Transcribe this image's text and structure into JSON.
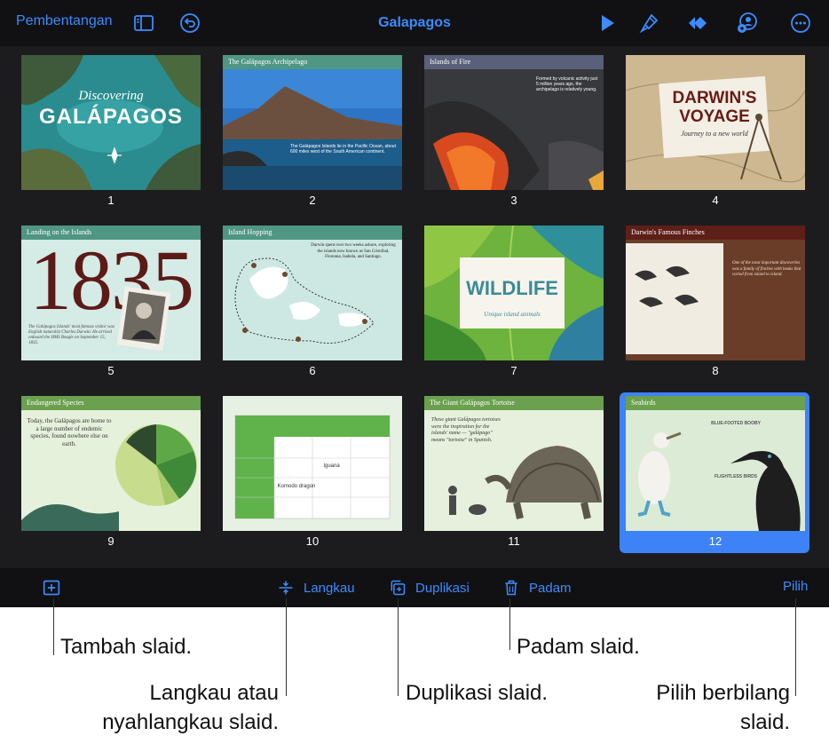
{
  "topbar": {
    "present_label": "Pembentangan",
    "title": "Galapagos",
    "icons": [
      "sidebar-icon",
      "undo-icon",
      "play-icon",
      "format-brush-icon",
      "animate-icon",
      "collaborate-icon",
      "more-icon"
    ]
  },
  "slides": [
    {
      "number": "1",
      "title": "Discovering",
      "big": "GALÁPAGOS"
    },
    {
      "number": "2",
      "title": "The Galápagos Archipelago",
      "bullet": "The Galápagos Islands lie in the Pacific Ocean, about 600 miles west of the South American continent."
    },
    {
      "number": "3",
      "title": "Islands of Fire",
      "text": "Formed by volcanic activity just 5 million years ago, the archipelago is relatively young."
    },
    {
      "number": "4",
      "title": "DARWIN'S VOYAGE",
      "subtitle": "Journey to a new world"
    },
    {
      "number": "5",
      "title": "Landing on the Islands",
      "big": "1835",
      "caption": "The Galápagos Islands' most famous visitor was English naturalist Charles Darwin. He arrived onboard the HMS Beagle on September 15, 1835."
    },
    {
      "number": "6",
      "title": "Island Hopping",
      "text": "Darwin spent over two weeks ashore, exploring the islands now known as San Cristóbal, Floreana, Isabela, and Santiago."
    },
    {
      "number": "7",
      "title": "WILDLIFE",
      "subtitle": "Unique island animals"
    },
    {
      "number": "8",
      "title": "Darwin's Famous Finches",
      "text": "One of the most important discoveries was a family of finches with beaks that varied from island to island."
    },
    {
      "number": "9",
      "title": "Endangered Species",
      "text": "Today, the Galápagos are home to a large number of endemic species, found nowhere else on earth."
    },
    {
      "number": "10",
      "cell_a": "Iguana",
      "cell_b": "Komodo dragon"
    },
    {
      "number": "11",
      "title": "The Giant Galápagos Tortoise",
      "text": "These giant Galápagos tortoises were the inspiration for the islands' name — \"galápago\" means \"tortoise\" in Spanish."
    },
    {
      "number": "12",
      "title": "Seabirds",
      "label_a": "BLUE-FOOTED BOOBY",
      "label_b": "FLIGHTLESS BIRDS",
      "selected": true
    }
  ],
  "toolbar": {
    "add_icon": "add-slide-icon",
    "skip_label": "Langkau",
    "duplicate_label": "Duplikasi",
    "delete_label": "Padam",
    "select_label": "Pilih"
  },
  "callouts": {
    "add": "Tambah slaid.",
    "skip_line1": "Langkau atau",
    "skip_line2": "nyahlangkau slaid.",
    "duplicate": "Duplikasi slaid.",
    "delete": "Padam slaid.",
    "select_line1": "Pilih berbilang",
    "select_line2": "slaid."
  },
  "colors": {
    "accent": "#3d8bff",
    "selection": "#3d82f7",
    "app_bg": "#1c1c1e",
    "bar_bg": "#111113"
  }
}
